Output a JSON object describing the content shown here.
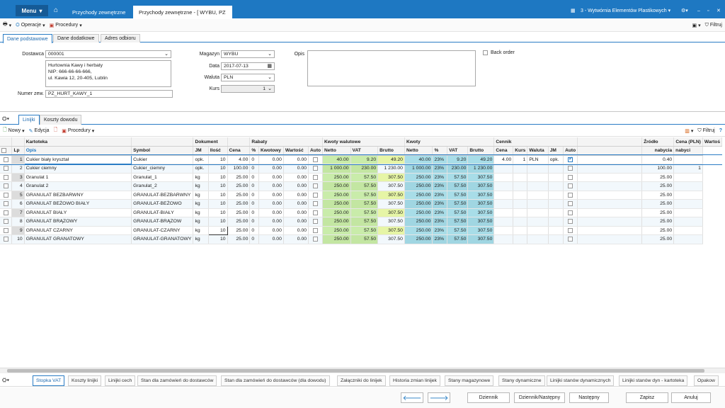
{
  "topbar": {
    "menu": "Menu",
    "tab1": "Przychody zewnętrzne",
    "tab2": "Przychody zewnętrzne - [ WYBU, PZ",
    "company": "3 - Wytwórnia Elementów Plastikowych"
  },
  "toolbar": {
    "operacje": "Operacje",
    "procedury": "Procedury",
    "filtruj": "Filtruj"
  },
  "subtabs": [
    "Dane podstawowe",
    "Dane dodatkowe",
    "Adres odbioru"
  ],
  "form": {
    "dostawca_label": "Dostawca",
    "dostawca": "000001",
    "address": [
      "Hurtownia Kawy i herbaty",
      "NIP: 666-66-66-666,",
      "ul. Kawia 12, 20-405, Lublin"
    ],
    "numer_label": "Numer zew.",
    "numer": "PZ_HURT_KAWY_1",
    "magazyn_label": "Magazyn",
    "magazyn": "WYBU",
    "data_label": "Data",
    "data": "2017-07-13",
    "waluta_label": "Waluta",
    "waluta": "PLN",
    "kurs_label": "Kurs",
    "kurs": "1",
    "opis_label": "Opis",
    "backorder": "Back order"
  },
  "gridtabs": [
    "Linijki",
    "Koszty dowodu"
  ],
  "gridtoolbar": {
    "nowy": "Nowy",
    "edycja": "Edycja",
    "procedury": "Procedury",
    "filtruj": "Filtruj"
  },
  "columns": {
    "groups": {
      "kartoteka": "Kartoteka",
      "dokument": "Dokument",
      "rabaty": "Rabaty",
      "kwoty_walutowe": "Kwoty walutowe",
      "kwoty": "Kwoty",
      "cennik": "Cennik",
      "zrodlo": "Źródło",
      "cena_pln": "Cena (PLN)",
      "wartosc": "Wartoś"
    },
    "sub": {
      "lp": "Lp",
      "opis": "Opis",
      "symbol": "Symbol",
      "jm": "JM",
      "ilosc": "Ilość",
      "cena": "Cena",
      "proc": "%",
      "kwotowy": "Kwotowy",
      "wartosc": "Wartość",
      "auto": "Auto",
      "netto": "Netto",
      "vat": "VAT",
      "brutto": "Brutto",
      "knetto": "Netto",
      "kproc": "%",
      "kvat": "VAT",
      "kbrutto": "Brutto",
      "ccena": "Cena",
      "kurs": "Kurs",
      "waluta": "Waluta",
      "cjm": "JM",
      "cauto": "Auto",
      "nabycia": "nabycia",
      "wnabycia": "nabyci"
    }
  },
  "rows": [
    {
      "lp": "1",
      "opis": "Cukier biały kryształ",
      "symbol": "Cukier",
      "jm": "opk.",
      "ilosc": "10",
      "cena": "4.00",
      "proc": "0",
      "kwotowy": "0.00",
      "wartosc": "0.00",
      "netto": "40.00",
      "vat": "9.20",
      "brutto": "49.20",
      "knetto": "40.00",
      "kproc": "23%",
      "kvat": "9.20",
      "kbrutto": "49.20",
      "ccena": "4.00",
      "kurs": "1",
      "waluta": "PLN",
      "cjm": "opk.",
      "cauto": true,
      "nabycia": "0.40",
      "wn": ""
    },
    {
      "lp": "2",
      "opis": "Cukier ciemny",
      "symbol": "Cukier_ciemny",
      "jm": "opk.",
      "ilosc": "10",
      "cena": "100.00",
      "proc": "0",
      "kwotowy": "0.00",
      "wartosc": "0.00",
      "netto": "1 000.00",
      "vat": "230.00",
      "brutto": "1 230.00",
      "knetto": "1 000.00",
      "kproc": "23%",
      "kvat": "230.00",
      "kbrutto": "1 230.00",
      "ccena": "",
      "kurs": "",
      "waluta": "",
      "cjm": "",
      "cauto": false,
      "nabycia": "100.00",
      "wn": "1"
    },
    {
      "lp": "3",
      "opis": "Granulat 1",
      "symbol": "Granulat_1",
      "jm": "kg",
      "ilosc": "10",
      "cena": "25.00",
      "proc": "0",
      "kwotowy": "0.00",
      "wartosc": "0.00",
      "netto": "250.00",
      "vat": "57.50",
      "brutto": "307.50",
      "knetto": "250.00",
      "kproc": "23%",
      "kvat": "57.50",
      "kbrutto": "307.50",
      "ccena": "",
      "kurs": "",
      "waluta": "",
      "cjm": "",
      "cauto": false,
      "nabycia": "25.00",
      "wn": ""
    },
    {
      "lp": "4",
      "opis": "Granulat 2",
      "symbol": "Granulat_2",
      "jm": "kg",
      "ilosc": "10",
      "cena": "25.00",
      "proc": "0",
      "kwotowy": "0.00",
      "wartosc": "0.00",
      "netto": "250.00",
      "vat": "57.50",
      "brutto": "307.50",
      "knetto": "250.00",
      "kproc": "23%",
      "kvat": "57.50",
      "kbrutto": "307.50",
      "ccena": "",
      "kurs": "",
      "waluta": "",
      "cjm": "",
      "cauto": false,
      "nabycia": "25.00",
      "wn": ""
    },
    {
      "lp": "5",
      "opis": "GRANULAT BEZBARWNY",
      "symbol": "GRANULAT-BEZBARWNY",
      "jm": "kg",
      "ilosc": "10",
      "cena": "25.00",
      "proc": "0",
      "kwotowy": "0.00",
      "wartosc": "0.00",
      "netto": "250.00",
      "vat": "57.50",
      "brutto": "307.50",
      "knetto": "250.00",
      "kproc": "23%",
      "kvat": "57.50",
      "kbrutto": "307.50",
      "ccena": "",
      "kurs": "",
      "waluta": "",
      "cjm": "",
      "cauto": false,
      "nabycia": "25.00",
      "wn": ""
    },
    {
      "lp": "6",
      "opis": "GRANULAT BEŻOWO BIAŁY",
      "symbol": "GRANULAT-BEŻOWO",
      "jm": "kg",
      "ilosc": "10",
      "cena": "25.00",
      "proc": "0",
      "kwotowy": "0.00",
      "wartosc": "0.00",
      "netto": "250.00",
      "vat": "57.50",
      "brutto": "307.50",
      "knetto": "250.00",
      "kproc": "23%",
      "kvat": "57.50",
      "kbrutto": "307.50",
      "ccena": "",
      "kurs": "",
      "waluta": "",
      "cjm": "",
      "cauto": false,
      "nabycia": "25.00",
      "wn": ""
    },
    {
      "lp": "7",
      "opis": "GRANULAT BIAŁY",
      "symbol": "GRANULAT-BIAŁY",
      "jm": "kg",
      "ilosc": "10",
      "cena": "25.00",
      "proc": "0",
      "kwotowy": "0.00",
      "wartosc": "0.00",
      "netto": "250.00",
      "vat": "57.50",
      "brutto": "307.50",
      "knetto": "250.00",
      "kproc": "23%",
      "kvat": "57.50",
      "kbrutto": "307.50",
      "ccena": "",
      "kurs": "",
      "waluta": "",
      "cjm": "",
      "cauto": false,
      "nabycia": "25.00",
      "wn": ""
    },
    {
      "lp": "8",
      "opis": "GRANULAT BRĄZOWY",
      "symbol": "GRANULAT-BRĄZOW",
      "jm": "kg",
      "ilosc": "10",
      "cena": "25.00",
      "proc": "0",
      "kwotowy": "0.00",
      "wartosc": "0.00",
      "netto": "250.00",
      "vat": "57.50",
      "brutto": "307.50",
      "knetto": "250.00",
      "kproc": "23%",
      "kvat": "57.50",
      "kbrutto": "307.50",
      "ccena": "",
      "kurs": "",
      "waluta": "",
      "cjm": "",
      "cauto": false,
      "nabycia": "25.00",
      "wn": ""
    },
    {
      "lp": "9",
      "opis": "GRANULAT CZARNY",
      "symbol": "GRANULAT-CZARNY",
      "jm": "kg",
      "ilosc": "10",
      "cena": "25.00",
      "proc": "0",
      "kwotowy": "0.00",
      "wartosc": "0.00",
      "netto": "250.00",
      "vat": "57.50",
      "brutto": "307.50",
      "knetto": "250.00",
      "kproc": "23%",
      "kvat": "57.50",
      "kbrutto": "307.50",
      "ccena": "",
      "kurs": "",
      "waluta": "",
      "cjm": "",
      "cauto": false,
      "nabycia": "25.00",
      "wn": ""
    },
    {
      "lp": "10",
      "opis": "GRANULAT GRANATOWY",
      "symbol": "GRANULAT-GRANATOWY",
      "jm": "kg",
      "ilosc": "10",
      "cena": "25.00",
      "proc": "0",
      "kwotowy": "0.00",
      "wartosc": "0.00",
      "netto": "250.00",
      "vat": "57.50",
      "brutto": "307.50",
      "knetto": "250.00",
      "kproc": "23%",
      "kvat": "57.50",
      "kbrutto": "307.50",
      "ccena": "",
      "kurs": "",
      "waluta": "",
      "cjm": "",
      "cauto": false,
      "nabycia": "25.00",
      "wn": ""
    }
  ],
  "bottomtabs": [
    "Stopka VAT",
    "Koszty linijki",
    "Linijki cech",
    "Stan dla zamówień do dostawców",
    "Stan dla zamówień do dostawców (dla dowodu)",
    "Załączniki do linijek",
    "Historia zmian linijek",
    "Stany magazynowe",
    "Stany dynamiczne",
    "Linijki stanów dynamicznych",
    "Linijki stanów dyn - kartoteka",
    "Opakow"
  ],
  "footer": {
    "dziennik": "Dziennik",
    "dziennik_nastepny": "Dziennik/Następny",
    "nastepny": "Następny",
    "zapisz": "Zapisz",
    "anuluj": "Anuluj"
  },
  "colors": {
    "brand": "#1e78c2",
    "green": "#c9ecaa",
    "teal": "#a8dde8"
  }
}
